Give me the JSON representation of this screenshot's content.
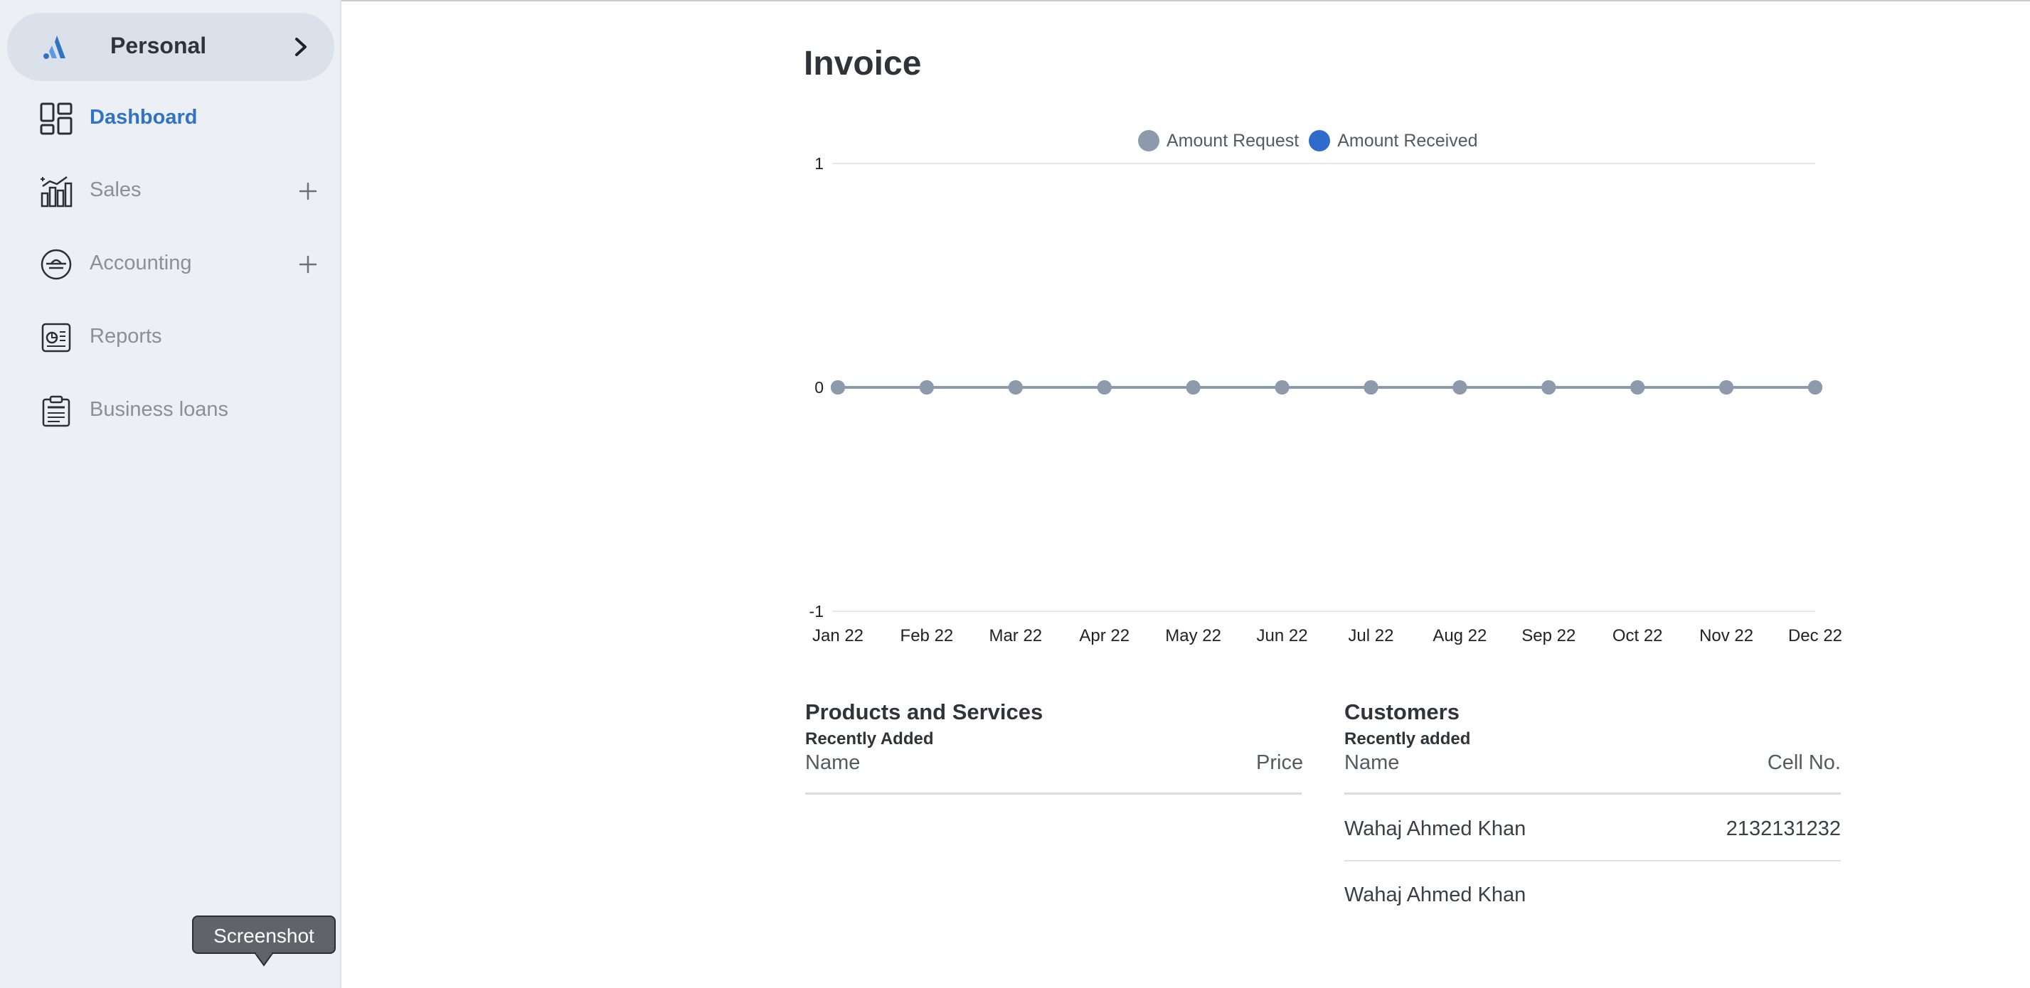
{
  "sidebar": {
    "workspace": {
      "label": "Personal"
    },
    "items": [
      {
        "label": "Dashboard",
        "active": true,
        "icon": "dashboard-icon"
      },
      {
        "label": "Sales",
        "expandable": true,
        "icon": "sales-chart-icon"
      },
      {
        "label": "Accounting",
        "expandable": true,
        "icon": "scale-icon"
      },
      {
        "label": "Reports",
        "icon": "report-icon"
      },
      {
        "label": "Business loans",
        "icon": "loan-clipboard-icon"
      }
    ],
    "tooltip": "Screenshot"
  },
  "main": {
    "title": "Invoice",
    "products": {
      "title": "Products and Services",
      "subtitle": "Recently Added",
      "columns": [
        "Name",
        "Price"
      ]
    },
    "customers": {
      "title": "Customers",
      "subtitle": "Recently added",
      "columns": [
        "Name",
        "Cell No."
      ],
      "rows": [
        {
          "name": "Wahaj Ahmed Khan",
          "cell": "2132131232"
        },
        {
          "name": "Wahaj Ahmed Khan",
          "cell": ""
        }
      ]
    }
  },
  "colors": {
    "accent": "#2f74c4",
    "series_request": "#8d9aab",
    "series_received": "#2e6bcb",
    "sidebar_bg": "#eceff4"
  },
  "chart_data": {
    "type": "line",
    "categories": [
      "Jan 22",
      "Feb 22",
      "Mar 22",
      "Apr 22",
      "May 22",
      "Jun 22",
      "Jul 22",
      "Aug 22",
      "Sep 22",
      "Oct 22",
      "Nov 22",
      "Dec 22"
    ],
    "series": [
      {
        "name": "Amount Request",
        "color": "#8d9aab",
        "values": [
          0,
          0,
          0,
          0,
          0,
          0,
          0,
          0,
          0,
          0,
          0,
          0
        ]
      },
      {
        "name": "Amount Received",
        "color": "#2e6bcb",
        "values": [
          0,
          0,
          0,
          0,
          0,
          0,
          0,
          0,
          0,
          0,
          0,
          0
        ]
      }
    ],
    "y_ticks": [
      "1",
      "0",
      "-1"
    ],
    "ylim": [
      -1,
      1
    ],
    "legend_position": "top",
    "grid": true
  }
}
